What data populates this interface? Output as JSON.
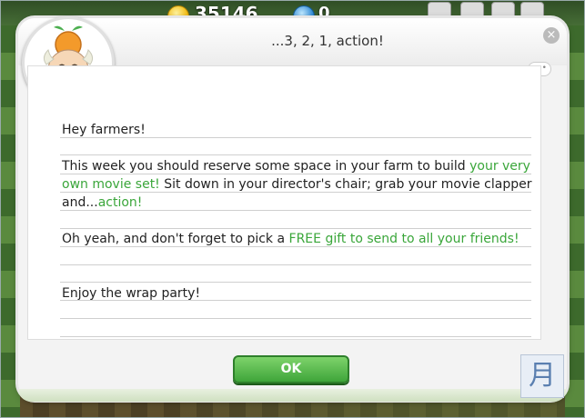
{
  "hud": {
    "coins": "35146",
    "gems": "0"
  },
  "dialog": {
    "title": "...3, 2, 1, action!",
    "close_label": "×",
    "ok_label": "OK",
    "greeting": "Hey farmers!",
    "p1_a": "This week you should reserve some space in your farm to build ",
    "p1_b": "your very own movie set!",
    "p1_c": " Sit down in your director's chair; grab your movie clapper and...",
    "p1_d": "action!",
    "p2_a": "Oh yeah, and don't forget to pick a ",
    "p2_b": "FREE gift to send to all your friends!",
    "p3": "Enjoy the wrap party!"
  },
  "icons": {
    "avatar": "farmer-elder-avatar",
    "coin": "coin-icon",
    "gem": "gem-icon",
    "corner": "月"
  },
  "colors": {
    "highlight": "#3aa63a",
    "ok_button": "#4fb544"
  }
}
